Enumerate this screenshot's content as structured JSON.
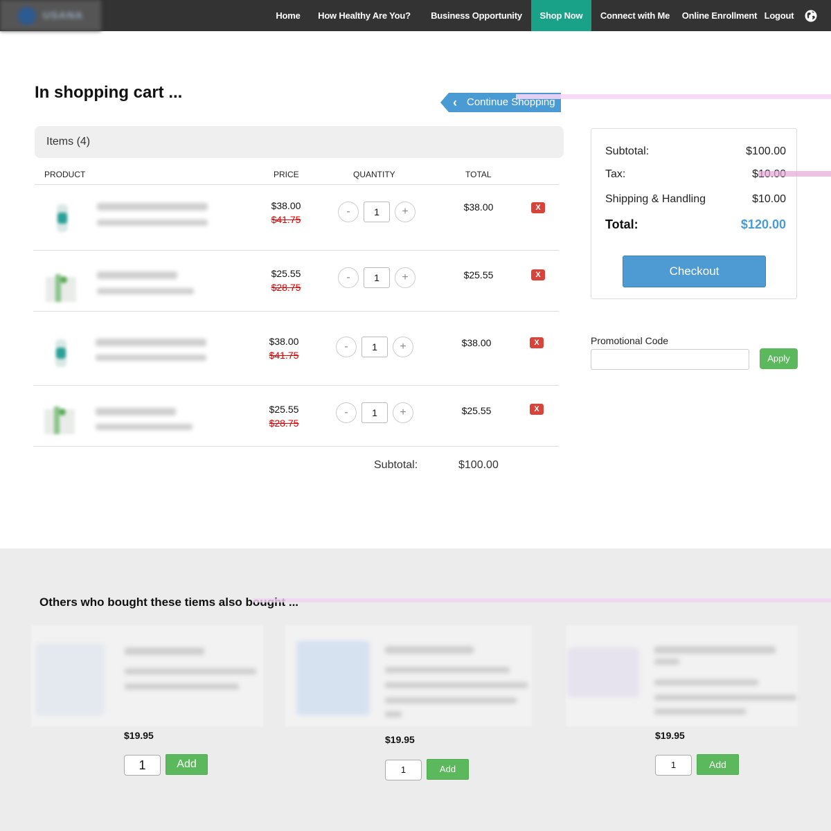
{
  "nav": {
    "logo_text": "USANA",
    "items": [
      {
        "label": "Home"
      },
      {
        "label": "How Healthy Are You?"
      },
      {
        "label": "Business Opportunity"
      },
      {
        "label": "Shop Now",
        "active": true
      },
      {
        "label": "Connect with Me"
      },
      {
        "label": "Online Enrollment"
      },
      {
        "label": "Logout"
      }
    ],
    "globe_icon": "globe-icon"
  },
  "cart": {
    "title": "In shopping cart ...",
    "continue_label": "Continue Shopping",
    "items_label": "Items (4)",
    "columns": [
      "PRODUCT",
      "PRICE",
      "QUANTITY",
      "TOTAL"
    ],
    "rows": [
      {
        "price": "$38.00",
        "old_price": "$41.75",
        "quantity": "1",
        "total": "$38.00",
        "remove": "X"
      },
      {
        "price": "$25.55",
        "old_price": "$28.75",
        "quantity": "1",
        "total": "$25.55",
        "remove": "X"
      },
      {
        "price": "$38.00",
        "old_price": "$41.75",
        "quantity": "1",
        "total": "$38.00",
        "remove": "X"
      },
      {
        "price": "$25.55",
        "old_price": "$28.75",
        "quantity": "1",
        "total": "$25.55",
        "remove": "X"
      }
    ],
    "minus": "-",
    "plus": "+",
    "subtotal_label": "Subtotal:",
    "subtotal_value": "$100.00"
  },
  "summary": {
    "subtotal_label": "Subtotal:",
    "subtotal_value": "$100.00",
    "tax_label": "Tax:",
    "tax_value": "$10.00",
    "shipping_label": "Shipping & Handling",
    "shipping_value": "$10.00",
    "total_label": "Total:",
    "total_value": "$120.00",
    "checkout_label": "Checkout"
  },
  "promo": {
    "label": "Promotional Code",
    "value": "",
    "apply_label": "Apply"
  },
  "reco": {
    "title": "Others who bought these tiems also bought ...",
    "products": [
      {
        "price": "$19.95",
        "quantity": "1",
        "add_label": "Add"
      },
      {
        "price": "$19.95",
        "quantity": "1",
        "add_label": "Add"
      },
      {
        "price": "$19.95",
        "quantity": "1",
        "add_label": "Add"
      }
    ]
  }
}
